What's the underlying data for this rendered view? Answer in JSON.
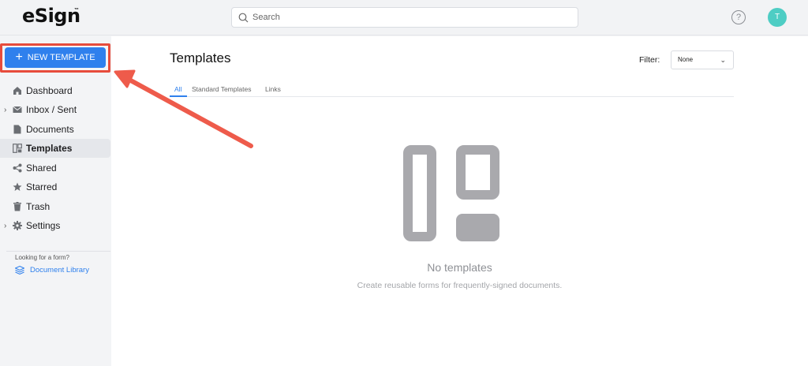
{
  "header": {
    "logo": "eSign",
    "logo_mark": "™",
    "search_placeholder": "Search",
    "help_icon": "?",
    "avatar_initial": "T"
  },
  "sidebar": {
    "new_button": "NEW TEMPLATE",
    "items": [
      {
        "label": "Dashboard",
        "icon": "home-icon",
        "expandable": false,
        "active": false
      },
      {
        "label": "Inbox / Sent",
        "icon": "mail-icon",
        "expandable": true,
        "active": false
      },
      {
        "label": "Documents",
        "icon": "document-icon",
        "expandable": false,
        "active": false
      },
      {
        "label": "Templates",
        "icon": "templates-icon",
        "expandable": false,
        "active": true
      },
      {
        "label": "Shared",
        "icon": "share-icon",
        "expandable": false,
        "active": false
      },
      {
        "label": "Starred",
        "icon": "star-icon",
        "expandable": false,
        "active": false
      },
      {
        "label": "Trash",
        "icon": "trash-icon",
        "expandable": false,
        "active": false
      },
      {
        "label": "Settings",
        "icon": "gear-icon",
        "expandable": true,
        "active": false
      }
    ],
    "hint": "Looking for a form?",
    "doc_library": "Document Library"
  },
  "main": {
    "title": "Templates",
    "filter_label": "Filter:",
    "filter_value": "None",
    "tabs": [
      {
        "label": "All",
        "active": true
      },
      {
        "label": "Standard Templates",
        "active": false
      },
      {
        "label": "Links",
        "active": false
      }
    ],
    "empty_title": "No templates",
    "empty_subtitle": "Create reusable forms for frequently-signed documents."
  },
  "colors": {
    "accent": "#2f80ed",
    "avatar": "#4ecdc4",
    "annotation": "#e74c3c",
    "illustration": "#a9a9ad"
  }
}
